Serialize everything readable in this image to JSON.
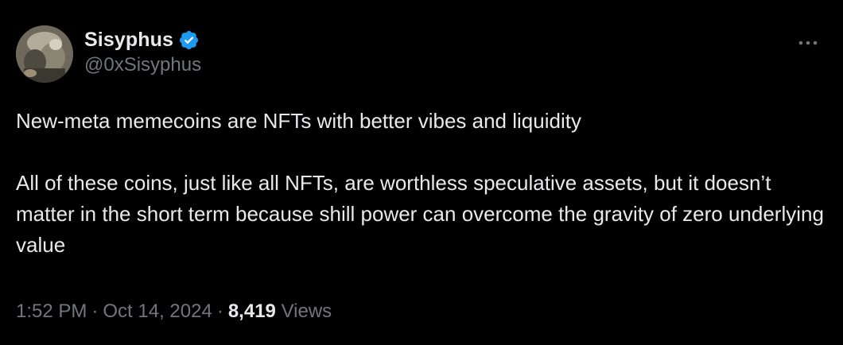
{
  "author": {
    "display_name": "Sisyphus",
    "handle": "@0xSisyphus",
    "verified_icon": "verified-badge-icon",
    "verified_color": "#1d9bf0"
  },
  "tweet": {
    "paragraph_1": "New-meta memecoins are NFTs with better vibes and liquidity",
    "paragraph_2": "All of these coins, just like all NFTs, are worthless speculative assets, but it doesn’t matter in the short term because shill power can overcome the gravity of zero underlying value"
  },
  "meta": {
    "time": "1:52 PM",
    "separator": "·",
    "date": "Oct 14, 2024",
    "views_count": "8,419",
    "views_label": "Views"
  },
  "actions": {
    "more_icon": "more-horizontal-icon"
  },
  "colors": {
    "background": "#000000",
    "primary_text": "#e7e9ea",
    "secondary_text": "#71767b"
  }
}
